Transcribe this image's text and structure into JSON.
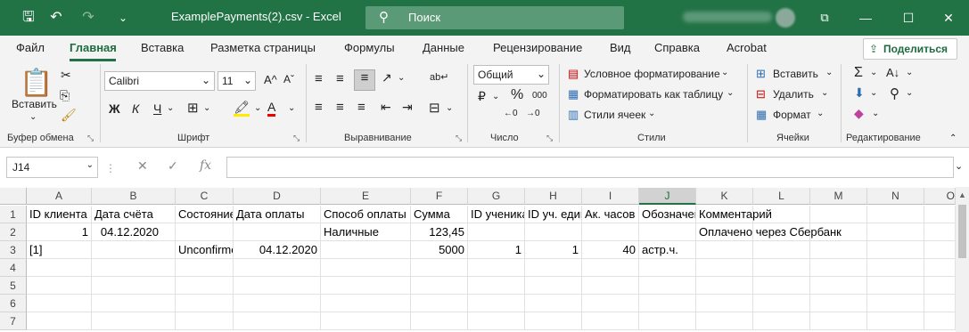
{
  "window": {
    "title": "ExamplePayments(2).csv  -  Excel",
    "search_placeholder": "Поиск",
    "minimize": "—",
    "restore": "❐",
    "maximize": "☐",
    "close": "✕"
  },
  "quick_access": {
    "save": "🖫",
    "undo": "↶",
    "redo": "↷",
    "customize": "⌄"
  },
  "menu": {
    "tabs": [
      "Файл",
      "Главная",
      "Вставка",
      "Разметка страницы",
      "Формулы",
      "Данные",
      "Рецензирование",
      "Вид",
      "Справка",
      "Acrobat"
    ],
    "share": "Поделиться"
  },
  "ribbon": {
    "clipboard": {
      "paste": "Вставить",
      "label": "Буфер обмена"
    },
    "font": {
      "name": "Calibri",
      "size": "11",
      "bold": "Ж",
      "italic": "К",
      "underline": "Ч",
      "label": "Шрифт",
      "grow": "A^",
      "shrink": "Aˇ"
    },
    "alignment": {
      "label": "Выравнивание"
    },
    "number": {
      "format": "Общий",
      "percent": "%",
      "thousands": "000",
      "label": "Число"
    },
    "styles": {
      "conditional": "Условное форматирование",
      "as_table": "Форматировать как таблицу",
      "cell_styles": "Стили ячеек",
      "label": "Стили"
    },
    "cells": {
      "insert": "Вставить",
      "delete": "Удалить",
      "format": "Формат",
      "label": "Ячейки"
    },
    "editing": {
      "label": "Редактирование"
    }
  },
  "formula_bar": {
    "name_box": "J14",
    "fx": "fx",
    "value": ""
  },
  "grid": {
    "selected_column": "J",
    "columns": [
      "A",
      "B",
      "C",
      "D",
      "E",
      "F",
      "G",
      "H",
      "I",
      "J",
      "K",
      "L",
      "M",
      "N",
      "O"
    ],
    "rows": [
      "1",
      "2",
      "3",
      "4",
      "5",
      "6",
      "7"
    ],
    "cells": {
      "r1": [
        "ID клиента",
        "Дата счёта",
        "Состояние",
        "Дата оплаты",
        "Способ оплаты",
        "Сумма",
        "ID ученика",
        "ID уч. единицы",
        "Ак. часов",
        "Обозначение",
        "Комментарий"
      ],
      "r2": {
        "A": "1",
        "B": "04.12.2020",
        "E": "Наличные",
        "F": "123,45",
        "K": "Оплачено через Сбербанк"
      },
      "r3": {
        "A": "[1]",
        "C": "Unconfirmed",
        "D": "04.12.2020",
        "F": "5000",
        "G": "1",
        "H": "1",
        "I": "40",
        "J": "астр.ч."
      }
    }
  }
}
